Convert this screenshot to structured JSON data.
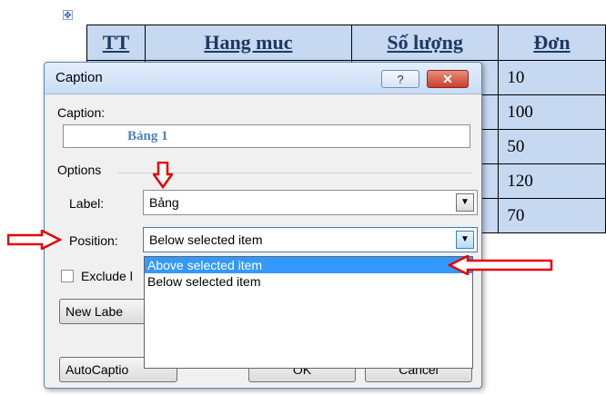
{
  "document": {
    "table_headers": [
      "TT",
      "Hang muc",
      "Số lượng",
      "Đơn"
    ],
    "quantity_values": [
      "10",
      "100",
      "50",
      "120",
      "70"
    ]
  },
  "dialog": {
    "title": "Caption",
    "help_button": "?",
    "close_button": "✕",
    "caption_label": "Caption:",
    "caption_value": "Bảng 1",
    "options_heading": "Options",
    "label_label": "Label:",
    "label_value": "Bảng",
    "position_label": "Position:",
    "position_value": "Below selected item",
    "position_options": [
      "Above selected item",
      "Below selected item"
    ],
    "exclude_label": "Exclude l",
    "new_label_button": "New Labe",
    "autocaption_button": "AutoCaptio",
    "ok_button": "OK",
    "cancel_button": "Cancel"
  },
  "colors": {
    "table_fill": "#c6d9f1",
    "highlight": "#3399ff",
    "annotation_arrows": "#e60000"
  },
  "icons": {
    "move_handle": "move-handle-icon",
    "dropdown": "chevron-down-icon",
    "annotation": "hollow-red-arrow"
  }
}
